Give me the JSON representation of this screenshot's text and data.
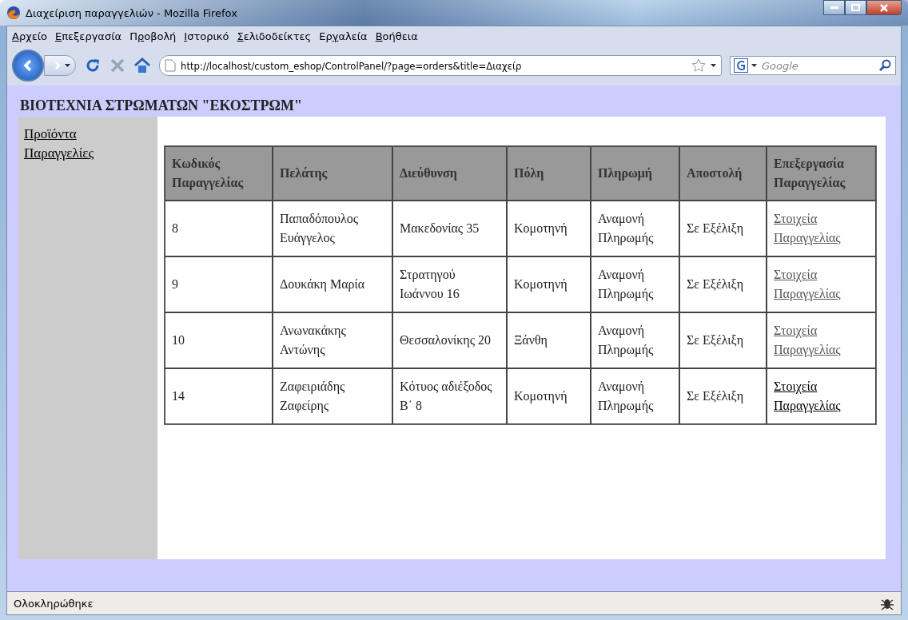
{
  "window": {
    "title": "Διαχείριση παραγγελιών - Mozilla Firefox"
  },
  "menu": [
    {
      "key": "Α",
      "post": "ρχείο"
    },
    {
      "key": "Ε",
      "post": "πεξεργασία"
    },
    {
      "pre": "Π",
      "key": "ρ",
      "post": "οβολή"
    },
    {
      "key": "Ι",
      "post": "στορικό"
    },
    {
      "key": "Σ",
      "post": "ελιδοδείκτες"
    },
    {
      "pre": "Ερ",
      "key": "γ",
      "post": "αλεία"
    },
    {
      "key": "Β",
      "post": "οήθεια"
    }
  ],
  "address_bar": {
    "value": "http://localhost/custom_eshop/ControlPanel/?page=orders&title=Διαχείρ"
  },
  "search": {
    "placeholder": "Google"
  },
  "page": {
    "heading": "ΒΙΟΤΕΧΝΙΑ ΣΤΡΩΜΑΤΩΝ \"ΕΚΟΣΤΡΩΜ\"",
    "sidebar": {
      "items": [
        "Προϊόντα",
        "Παραγγελίες"
      ]
    },
    "table": {
      "columns": [
        "Κωδικός Παραγγελίας",
        "Πελάτης",
        "Διεύθυνση",
        "Πόλη",
        "Πληρωμή",
        "Αποστολή",
        "Επεξεργασία Παραγγελίας"
      ],
      "rows": [
        {
          "cells": [
            "8",
            "Παπαδόπουλος Ευάγγελος",
            "Μακεδονίας 35",
            "Κομοτηνή",
            "Αναμονή Πληρωμής",
            "Σε Εξέλιξη"
          ],
          "link": "Στοιχεία Παραγγελίας",
          "visited": true
        },
        {
          "cells": [
            "9",
            "Δουκάκη Μαρία",
            "Στρατηγού Ιωάννου 16",
            "Κομοτηνή",
            "Αναμονή Πληρωμής",
            "Σε Εξέλιξη"
          ],
          "link": "Στοιχεία Παραγγελίας",
          "visited": true
        },
        {
          "cells": [
            "10",
            "Ανωνακάκης Αντώνης",
            "Θεσσαλονίκης 20",
            "Ξάνθη",
            "Αναμονή Πληρωμής",
            "Σε Εξέλιξη"
          ],
          "link": "Στοιχεία Παραγγελίας",
          "visited": true
        },
        {
          "cells": [
            "14",
            "Ζαφειριάδης Ζαφείρης",
            "Κότυος αδιέξοδος Β΄ 8",
            "Κομοτηνή",
            "Αναμονή Πληρωμής",
            "Σε Εξέλιξη"
          ],
          "link": "Στοιχεία Παραγγελίας",
          "visited": false
        }
      ]
    }
  },
  "status_bar": {
    "text": "Ολοκληρώθηκε"
  }
}
